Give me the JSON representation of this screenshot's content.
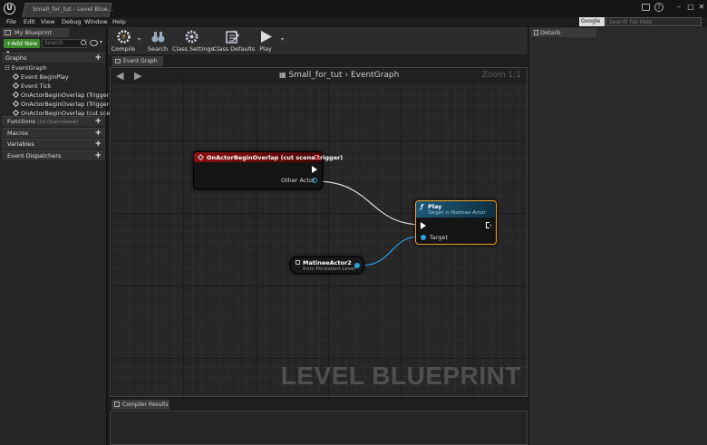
{
  "window": {
    "tab_title": "Small_for_tut - Level Blue..."
  },
  "menu": [
    "File",
    "Edit",
    "View",
    "Debug",
    "Window",
    "Help"
  ],
  "help_search": {
    "provider": "Google",
    "placeholder": "Search For Help"
  },
  "left_panel": {
    "tab_label": "My Blueprint",
    "add_new_label": "+Add New",
    "search_placeholder": "Search",
    "graphs_label": "Graphs",
    "event_graph_label": "EventGraph",
    "events": [
      "Event BeginPlay",
      "Event Tick",
      "OnActorBeginOverlap (TriggerBo",
      "OnActorBeginOverlap (TriggerBo",
      "OnActorBeginOverlap (cut scene"
    ],
    "functions_label": "Functions",
    "functions_note": "(20 Overridable)",
    "macros_label": "Macros",
    "variables_label": "Variables",
    "dispatchers_label": "Event Dispatchers"
  },
  "toolbar": {
    "compile": "Compile",
    "search": "Search",
    "class_settings": "Class Settings",
    "class_defaults": "Class Defaults",
    "play": "Play"
  },
  "graph": {
    "tab_label": "Event Graph",
    "breadcrumb_level": "Small_for_tut",
    "breadcrumb_graph": "EventGraph",
    "zoom": "Zoom 1:1",
    "watermark": "LEVEL BLUEPRINT",
    "event_node": {
      "title": "OnActorBeginOverlap (cut scene trigger)",
      "pin_other_actor": "Other Actor"
    },
    "play_node": {
      "title": "Play",
      "subtitle": "Target is Matinee Actor",
      "pin_target": "Target"
    },
    "actor_ref_node": {
      "title": "MatineeActor2",
      "subtitle": "from Persistent Level"
    }
  },
  "compiler_results_label": "Compiler Results",
  "details_label": "Details",
  "colors": {
    "event_header": "#8a1010",
    "play_header": "#1e5a7a",
    "selection_outline": "#f0a020",
    "pin_object": "#2aa0e0",
    "add_new": "#3c8a2a"
  }
}
